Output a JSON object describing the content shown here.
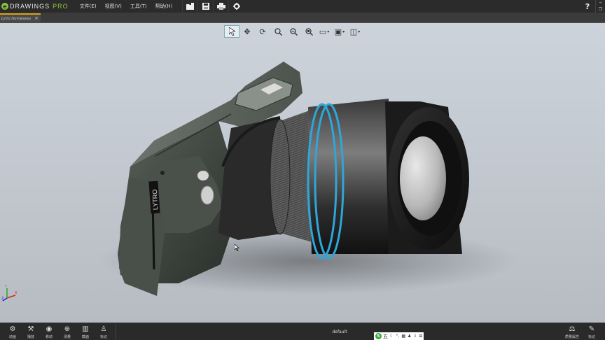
{
  "app": {
    "logo_main": "DRAWINGS",
    "logo_pro": "PRO",
    "logo_letter": "e"
  },
  "menu": {
    "items": [
      "文件(E)",
      "视图(V)",
      "工具(T)",
      "帮助(H)"
    ]
  },
  "toolbar": {
    "icons": [
      "open-folder-icon",
      "save-icon",
      "print-icon",
      "settings-gear-icon"
    ],
    "help_label": "?"
  },
  "document_tab": {
    "label": "Lytro illumwaves",
    "close_label": "×"
  },
  "view_toolbar": {
    "tools": [
      "select-arrow-icon",
      "pan-icon",
      "rotate-icon",
      "zoom-to-fit-icon",
      "zoom-icon",
      "zoom-to-area-icon",
      "display-style-icon",
      "view-orientation-icon",
      "standard-view-icon"
    ],
    "active_tool": "select-arrow-icon"
  },
  "model": {
    "brand_text": "LYTRO"
  },
  "triad": {
    "x_label": "X",
    "y_label": "Y",
    "z_label": "Z"
  },
  "bottombar": {
    "left_items": [
      {
        "icon": "animate-icon",
        "label": "动画"
      },
      {
        "icon": "play-icon",
        "label": "播放"
      },
      {
        "icon": "move-icon",
        "label": "移动"
      },
      {
        "icon": "measure-icon",
        "label": "测量"
      },
      {
        "icon": "section-icon",
        "label": "截面"
      },
      {
        "icon": "stamp-icon",
        "label": "标记"
      }
    ],
    "configuration": "default",
    "ime_text": "五",
    "right_items": [
      {
        "icon": "mass-properties-icon",
        "label": "质量属性"
      },
      {
        "icon": "markup-pen-icon",
        "label": "标记"
      }
    ]
  },
  "colors": {
    "brand_green": "#8cc63f",
    "lens_ring_blue": "#2ea6d8",
    "camera_body": "#3b403b",
    "tab_accent": "#d4a017"
  }
}
